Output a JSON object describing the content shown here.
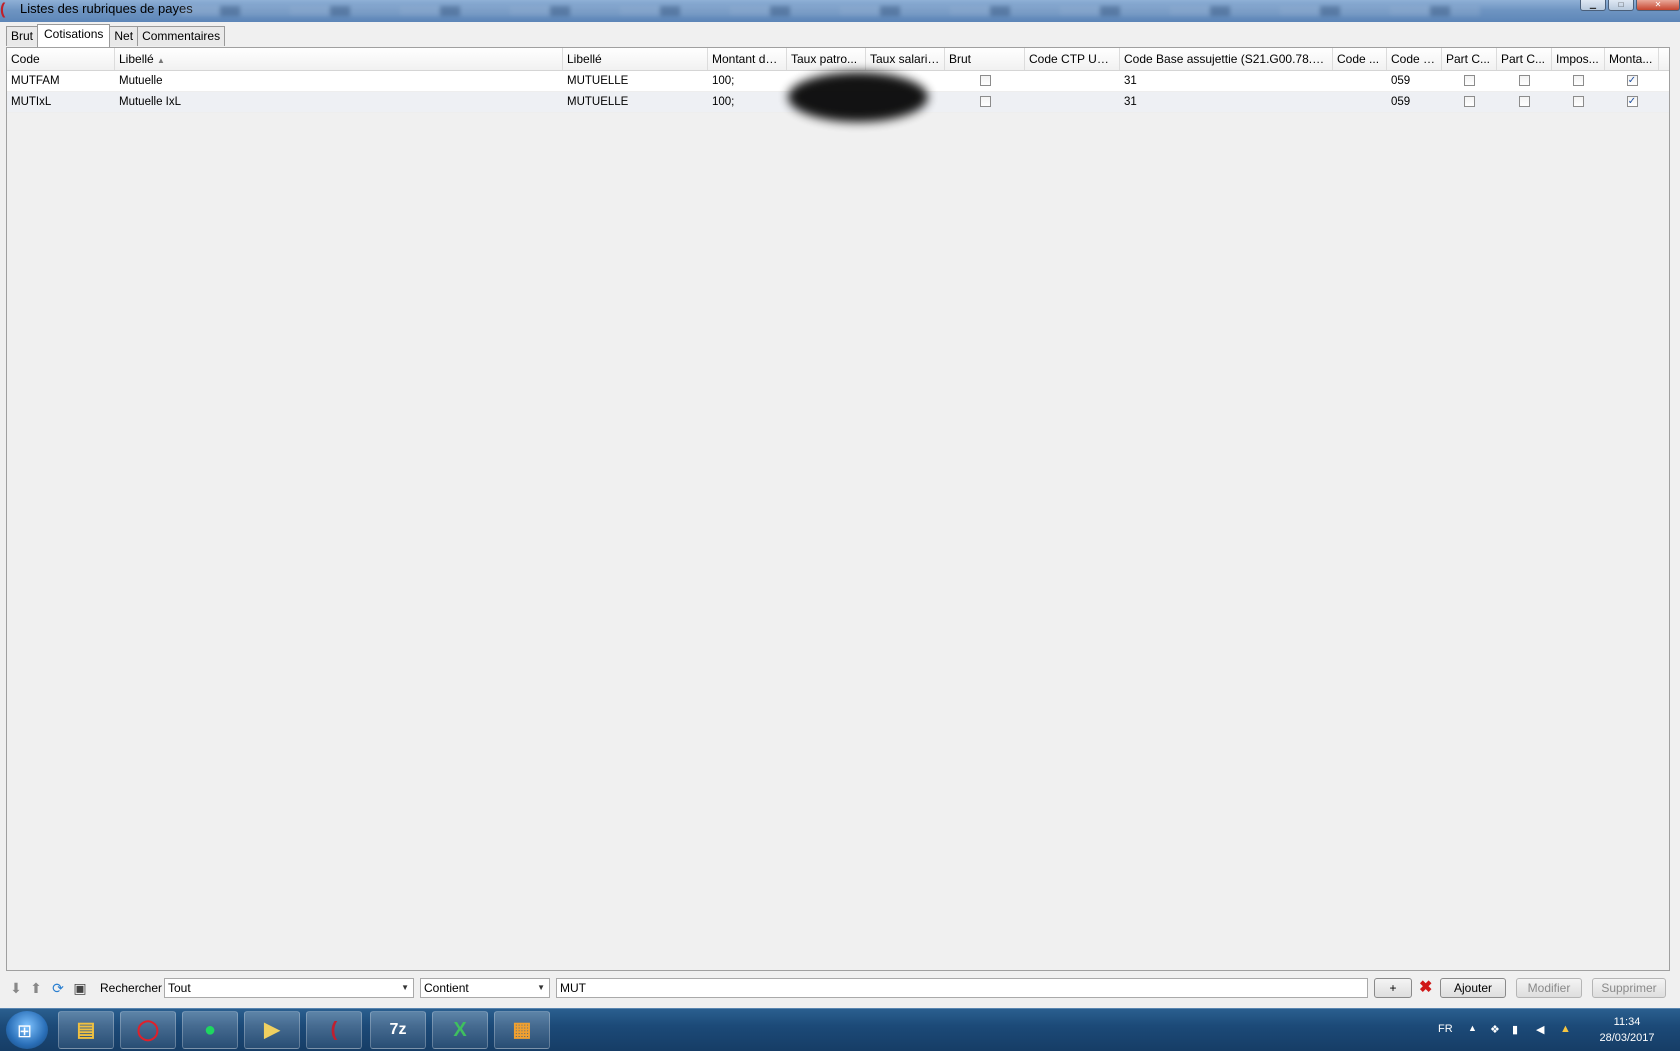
{
  "window": {
    "title": "Listes des rubriques de payes"
  },
  "tabs": [
    "Brut",
    "Cotisations",
    "Net",
    "Commentaires"
  ],
  "active_tab": "Cotisations",
  "table": {
    "columns": [
      "Code",
      "Libellé",
      "Libellé",
      "Montant de...",
      "Taux patro...",
      "Taux salarié...",
      "Brut",
      "Code CTP URS...",
      "Code Base assujettie (S21.G00.78.001)",
      "Code ...",
      "Code c...",
      "Part C...",
      "Part C...",
      "Impos...",
      "Monta..."
    ],
    "rows": [
      {
        "code": "MUTFAM",
        "libelle": "Mutuelle",
        "libelle2": "MUTUELLE",
        "montant": "100;",
        "taux_patro": "",
        "taux_salarie": "",
        "brut": false,
        "code_ctp": "",
        "code_base": "31",
        "code3": "",
        "code_c": "059",
        "part_c1": false,
        "part_c2": false,
        "impos": false,
        "monta": true
      },
      {
        "code": "MUTIxL",
        "libelle": "Mutuelle IxL",
        "libelle2": "MUTUELLE",
        "montant": "100;",
        "taux_patro": "",
        "taux_salarie": "",
        "brut": false,
        "code_ctp": "",
        "code_base": "31",
        "code3": "",
        "code_c": "059",
        "part_c1": false,
        "part_c2": false,
        "impos": false,
        "monta": true
      }
    ]
  },
  "search": {
    "label": "Rechercher",
    "field_value": "Tout",
    "operator_value": "Contient",
    "query": "MUT",
    "add_label": "+",
    "buttons": {
      "ajouter": "Ajouter",
      "modifier": "Modifier",
      "supprimer": "Supprimer"
    }
  },
  "taskbar": {
    "apps": [
      "file-explorer-icon",
      "opera-icon",
      "spotify-icon",
      "media-player-icon",
      "app-icon",
      "7zip-icon",
      "excel-icon",
      "video-app-icon"
    ],
    "app_glyphs": {
      "sevenzip": "7z",
      "excel": "X"
    },
    "language": "FR",
    "time": "11:34",
    "date": "28/03/2017"
  },
  "colors": {
    "accent_red": "#d01818",
    "taskbar": "#1c4a78",
    "check_blue": "#1f4fa0"
  }
}
